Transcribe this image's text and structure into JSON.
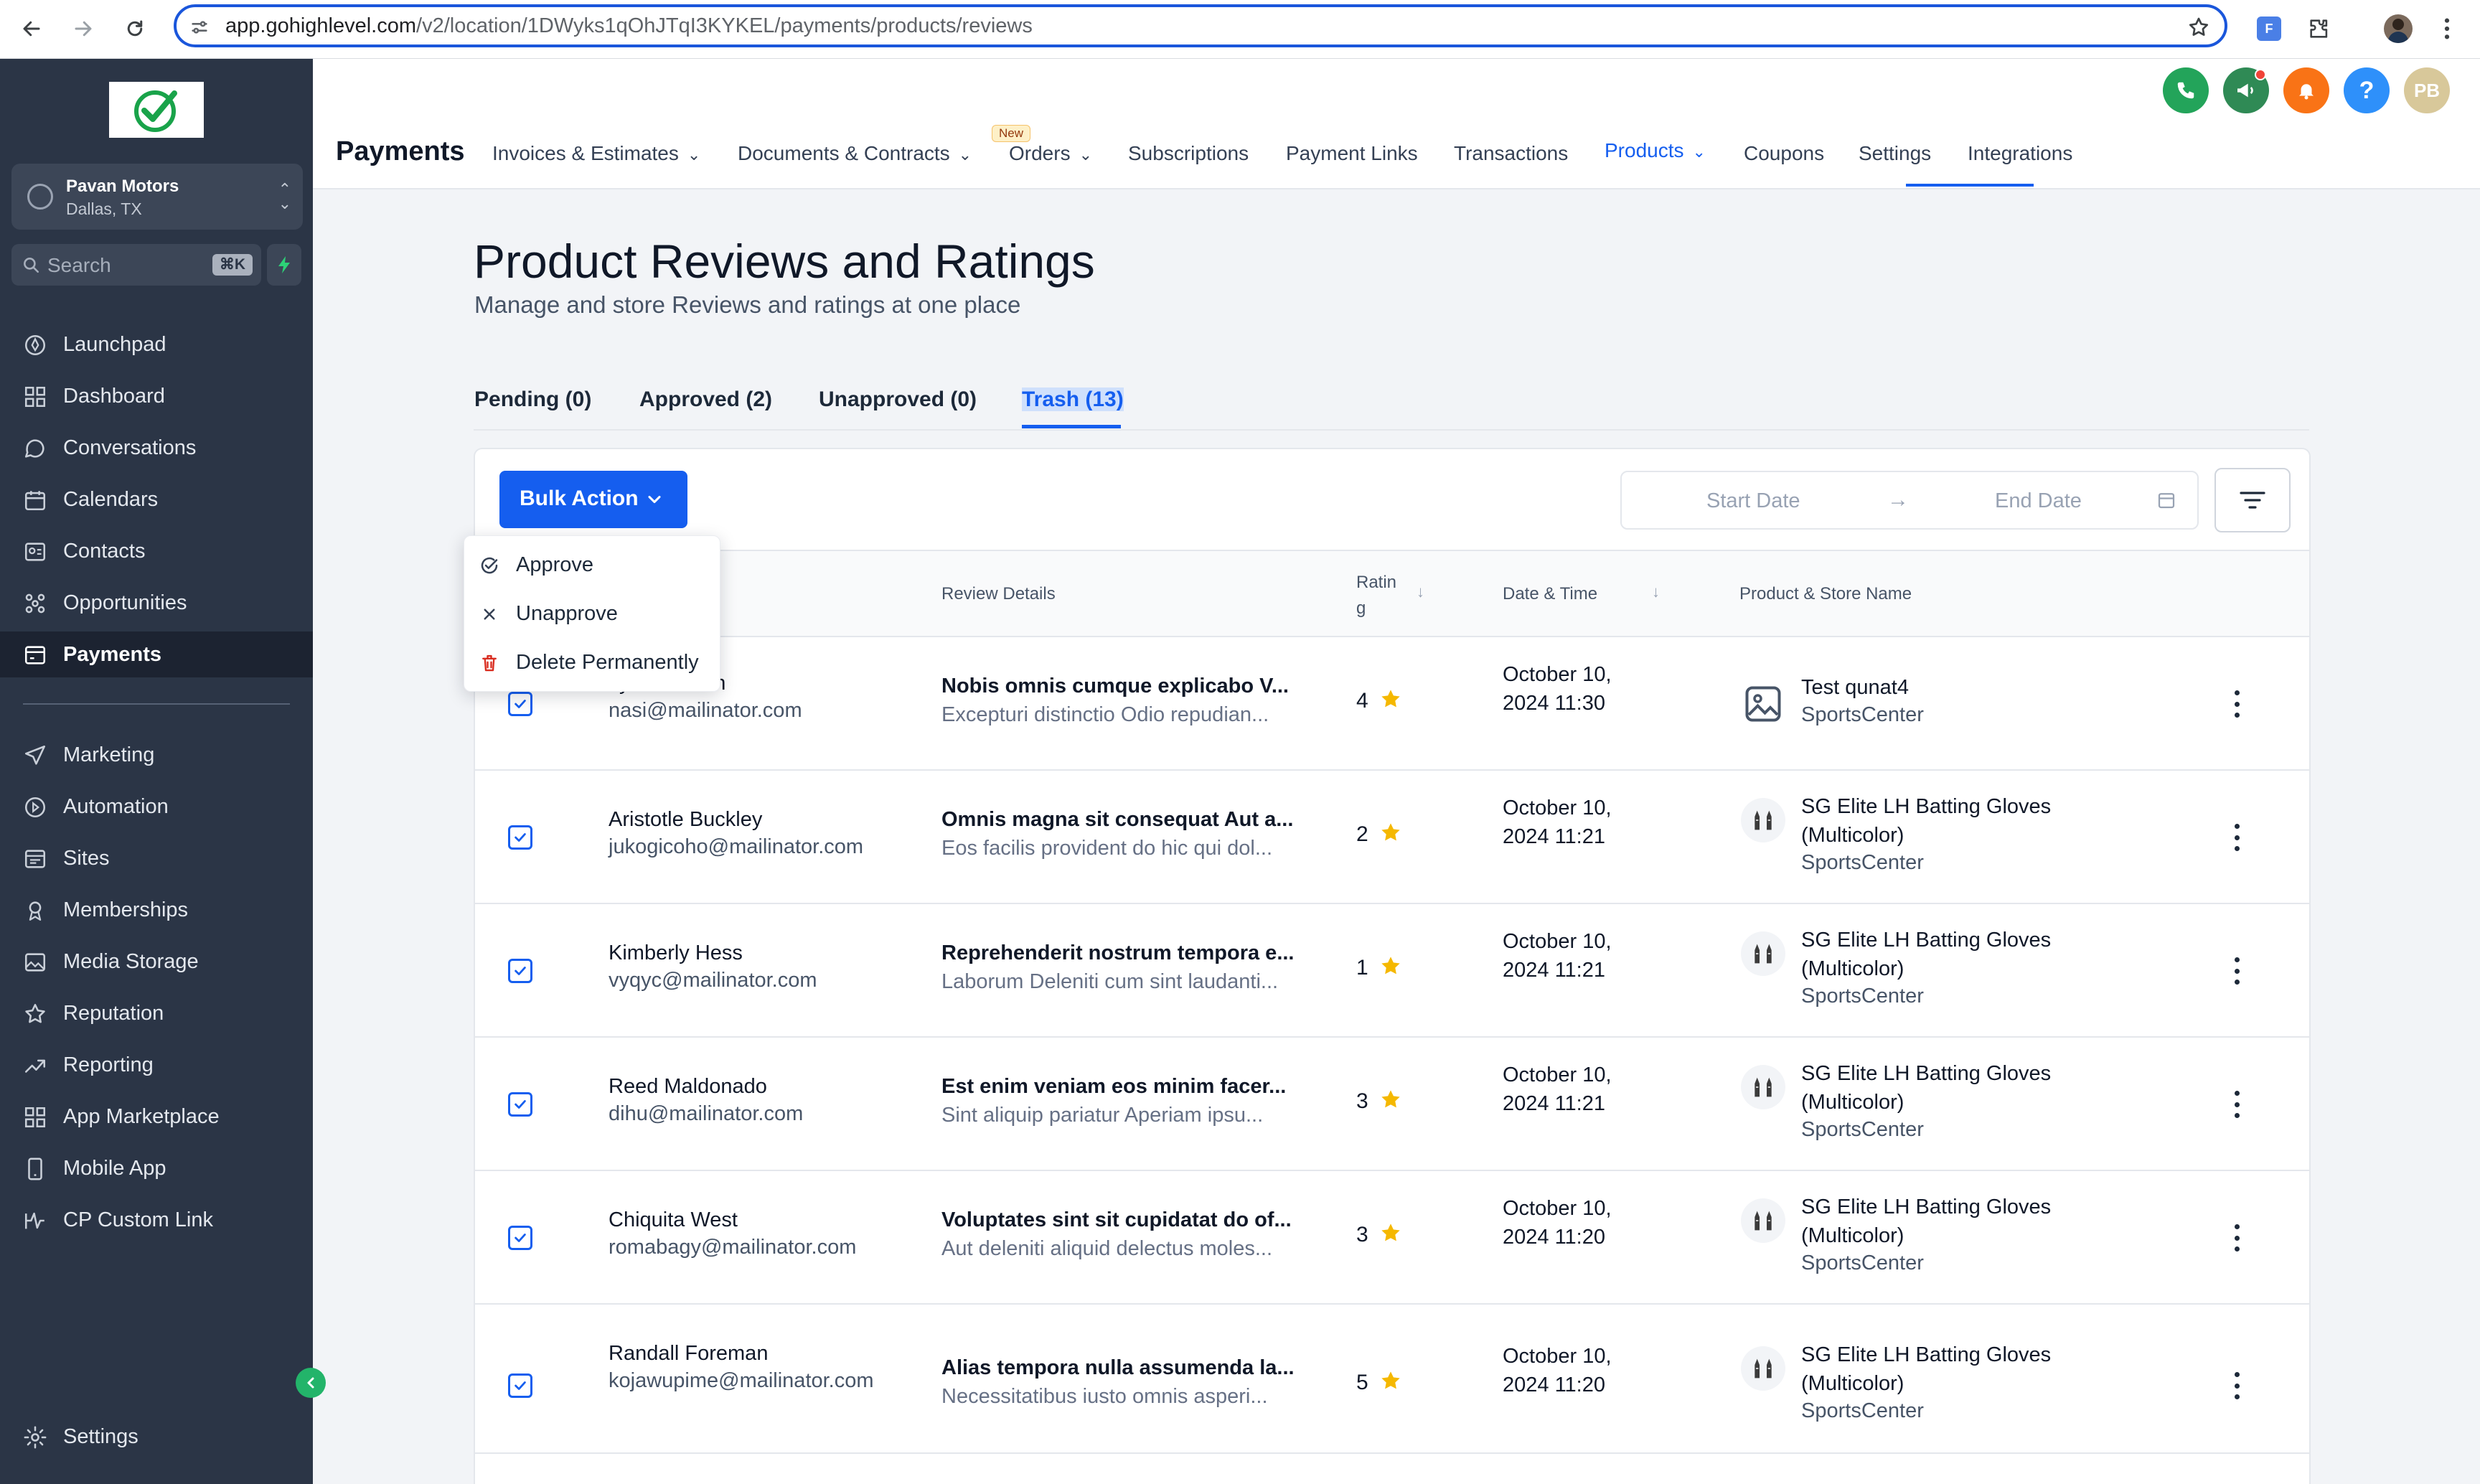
{
  "browser": {
    "url_host": "app.gohighlevel.com",
    "url_path": "/v2/location/1DWyks1qOhJTqI3KYKEL/payments/products/reviews"
  },
  "sidebar": {
    "account_name": "Pavan Motors",
    "account_location": "Dallas, TX",
    "search_placeholder": "Search",
    "search_shortcut": "⌘K",
    "items": [
      {
        "label": "Launchpad",
        "icon": "rocket-icon"
      },
      {
        "label": "Dashboard",
        "icon": "grid-icon"
      },
      {
        "label": "Conversations",
        "icon": "chat-bubble-icon"
      },
      {
        "label": "Calendars",
        "icon": "calendar-icon"
      },
      {
        "label": "Contacts",
        "icon": "contact-card-icon"
      },
      {
        "label": "Opportunities",
        "icon": "network-icon"
      },
      {
        "label": "Payments",
        "icon": "payments-icon"
      },
      {
        "label": "Marketing",
        "icon": "send-icon"
      },
      {
        "label": "Automation",
        "icon": "automation-icon"
      },
      {
        "label": "Sites",
        "icon": "sites-icon"
      },
      {
        "label": "Memberships",
        "icon": "membership-icon"
      },
      {
        "label": "Media Storage",
        "icon": "image-icon"
      },
      {
        "label": "Reputation",
        "icon": "star-icon"
      },
      {
        "label": "Reporting",
        "icon": "trend-icon"
      },
      {
        "label": "App Marketplace",
        "icon": "apps-icon"
      },
      {
        "label": "Mobile App",
        "icon": "phone-icon"
      },
      {
        "label": "CP Custom Link",
        "icon": "custom-link-icon"
      }
    ],
    "settings_label": "Settings"
  },
  "topnav": {
    "title": "Payments",
    "new_badge": "New",
    "items": [
      {
        "label": "Invoices & Estimates",
        "dropdown": true
      },
      {
        "label": "Documents & Contracts",
        "dropdown": true
      },
      {
        "label": "Orders",
        "dropdown": true
      },
      {
        "label": "Subscriptions",
        "dropdown": false
      },
      {
        "label": "Payment Links",
        "dropdown": false
      },
      {
        "label": "Transactions",
        "dropdown": false
      },
      {
        "label": "Products",
        "dropdown": true
      },
      {
        "label": "Coupons",
        "dropdown": false
      },
      {
        "label": "Settings",
        "dropdown": false
      },
      {
        "label": "Integrations",
        "dropdown": false
      }
    ],
    "avatar_initials": "PB"
  },
  "page": {
    "title": "Product Reviews and Ratings",
    "subtitle": "Manage and store Reviews and ratings at one place",
    "tabs": [
      {
        "label": "Pending (0)"
      },
      {
        "label": "Approved (2)"
      },
      {
        "label": "Unapproved (0)"
      },
      {
        "label": "Trash (13)"
      }
    ],
    "active_tab": "Trash (13)"
  },
  "toolbar": {
    "bulk_action": "Bulk Action",
    "start_date": "Start Date",
    "end_date": "End Date"
  },
  "bulk_menu": {
    "items": [
      {
        "label": "Approve",
        "icon": "check-circle-icon"
      },
      {
        "label": "Unapprove",
        "icon": "close-icon"
      },
      {
        "label": "Delete Permanently",
        "icon": "trash-icon"
      }
    ]
  },
  "table": {
    "columns": [
      "Review Details",
      "Rating",
      "Date & Time",
      "Product & Store Name"
    ],
    "rows": [
      {
        "name": "Lyle Franklin",
        "email": "nasi@mailinator.com",
        "review_title": "Nobis omnis cumque explicabo V...",
        "review_desc": "Excepturi distinctio Odio repudian...",
        "rating": 4,
        "date": "October 10, 2024 11:30",
        "product": "Test qunat4",
        "store": "SportsCenter",
        "checked": true
      },
      {
        "name": "Aristotle Buckley",
        "email": "jukogicoho@mailinator.com",
        "review_title": "Omnis magna sit consequat Aut a...",
        "review_desc": "Eos facilis provident do hic qui dol...",
        "rating": 2,
        "date": "October 10, 2024 11:21",
        "product": "SG Elite LH Batting Gloves (Multicolor)",
        "store": "SportsCenter",
        "checked": true
      },
      {
        "name": "Kimberly Hess",
        "email": "vyqyc@mailinator.com",
        "review_title": "Reprehenderit nostrum tempora e...",
        "review_desc": "Laborum Deleniti cum sint laudanti...",
        "rating": 1,
        "date": "October 10, 2024 11:21",
        "product": "SG Elite LH Batting Gloves (Multicolor)",
        "store": "SportsCenter",
        "checked": true
      },
      {
        "name": "Reed Maldonado",
        "email": "dihu@mailinator.com",
        "review_title": "Est enim veniam eos minim facer...",
        "review_desc": "Sint aliquip pariatur Aperiam ipsu...",
        "rating": 3,
        "date": "October 10, 2024 11:21",
        "product": "SG Elite LH Batting Gloves (Multicolor)",
        "store": "SportsCenter",
        "checked": true
      },
      {
        "name": "Chiquita West",
        "email": "romabagy@mailinator.com",
        "review_title": "Voluptates sint sit cupidatat do of...",
        "review_desc": "Aut deleniti aliquid delectus moles...",
        "rating": 3,
        "date": "October 10, 2024 11:20",
        "product": "SG Elite LH Batting Gloves (Multicolor)",
        "store": "SportsCenter",
        "checked": true
      },
      {
        "name": "Randall Foreman",
        "email": "kojawupime@mailinator.com",
        "review_title": "Alias tempora nulla assumenda la...",
        "review_desc": "Necessitatibus iusto omnis asperi...",
        "rating": 5,
        "date": "October 10, 2024 11:20",
        "product": "SG Elite LH Batting Gloves (Multicolor)",
        "store": "SportsCenter",
        "checked": true
      }
    ]
  },
  "colors": {
    "accent": "#155eef",
    "sidebar_bg": "#2b3546",
    "star": "#f5b800"
  }
}
